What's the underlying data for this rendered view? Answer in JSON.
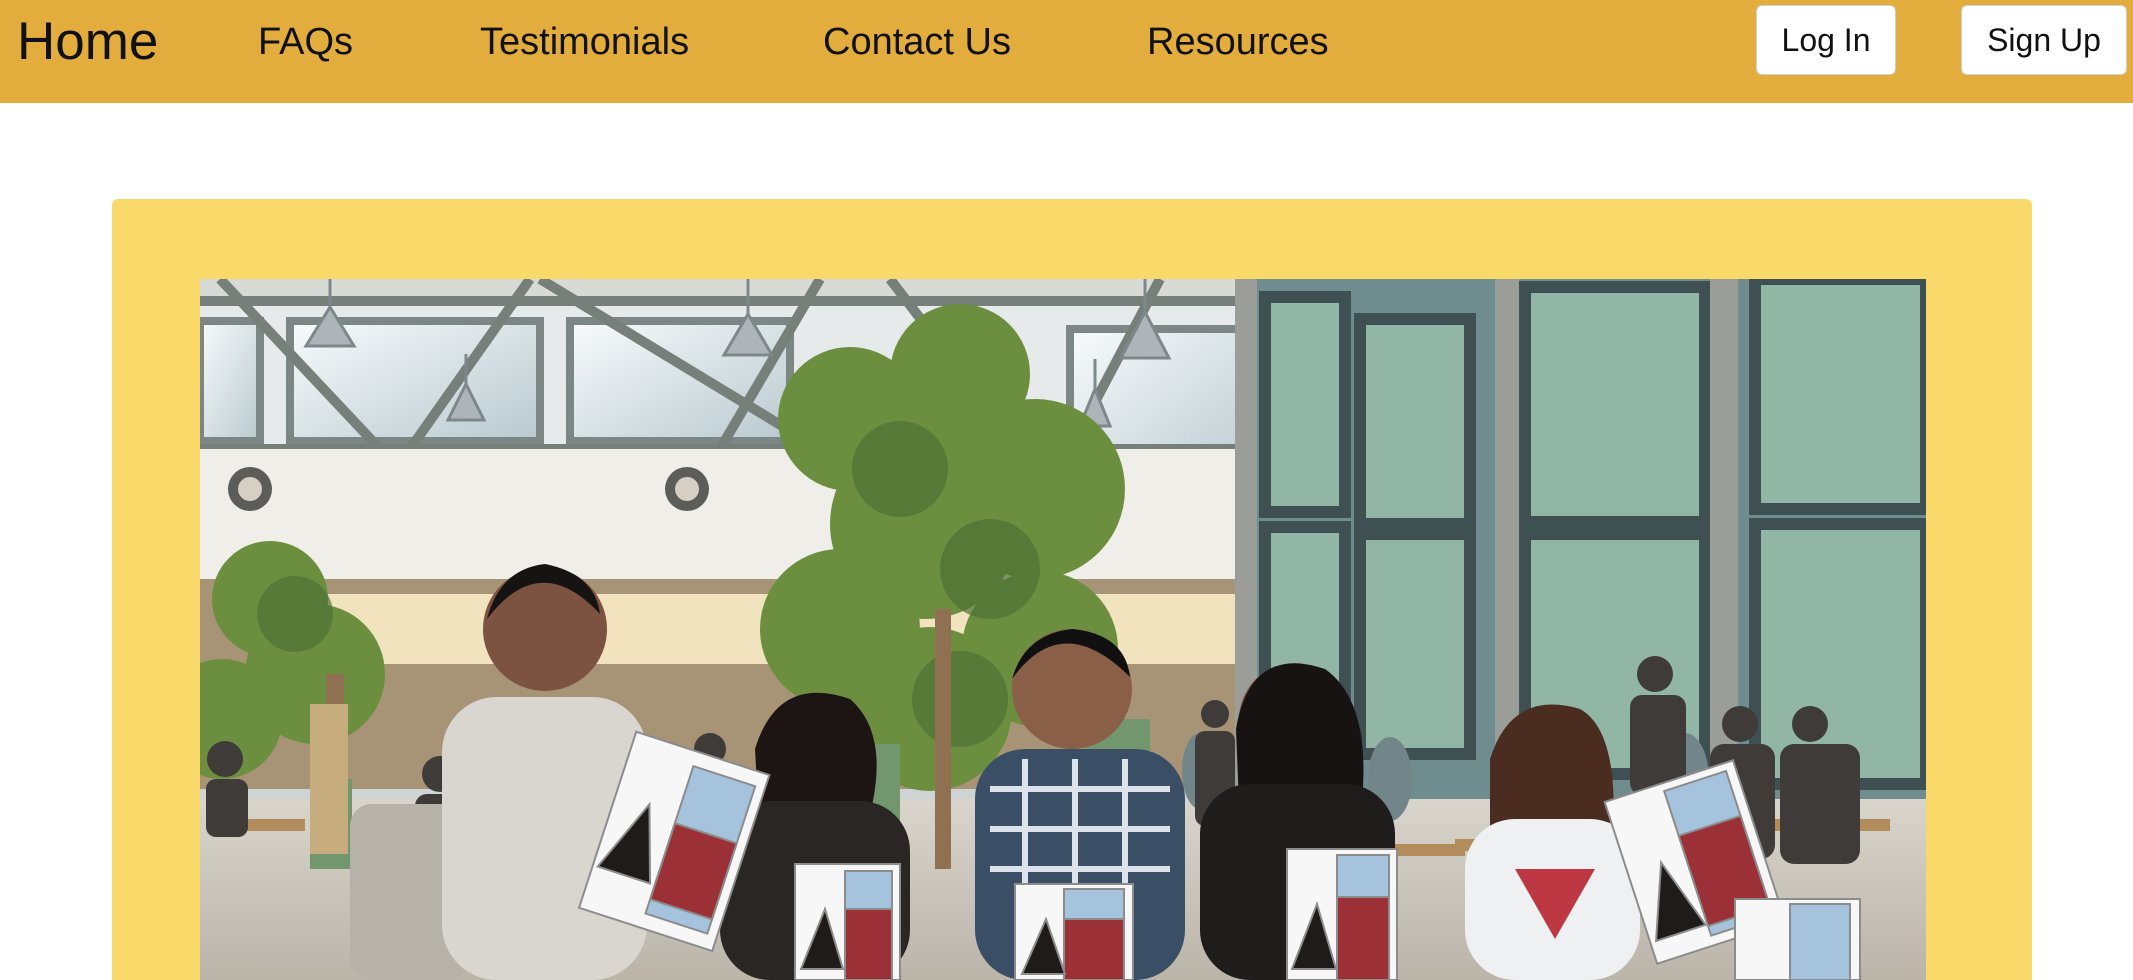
{
  "nav": {
    "brand": "Home",
    "links": [
      {
        "label": "FAQs"
      },
      {
        "label": "Testimonials"
      },
      {
        "label": "Contact Us"
      },
      {
        "label": "Resources"
      }
    ],
    "login_label": "Log In",
    "signup_label": "Sign Up"
  },
  "hero": {
    "image_description": "Photo of smiling students holding event flyers in a sunlit atrium cafeteria"
  },
  "colors": {
    "topbar": "#e2ad3c",
    "hero_background": "#f9d96a",
    "button_background": "#ffffff"
  }
}
